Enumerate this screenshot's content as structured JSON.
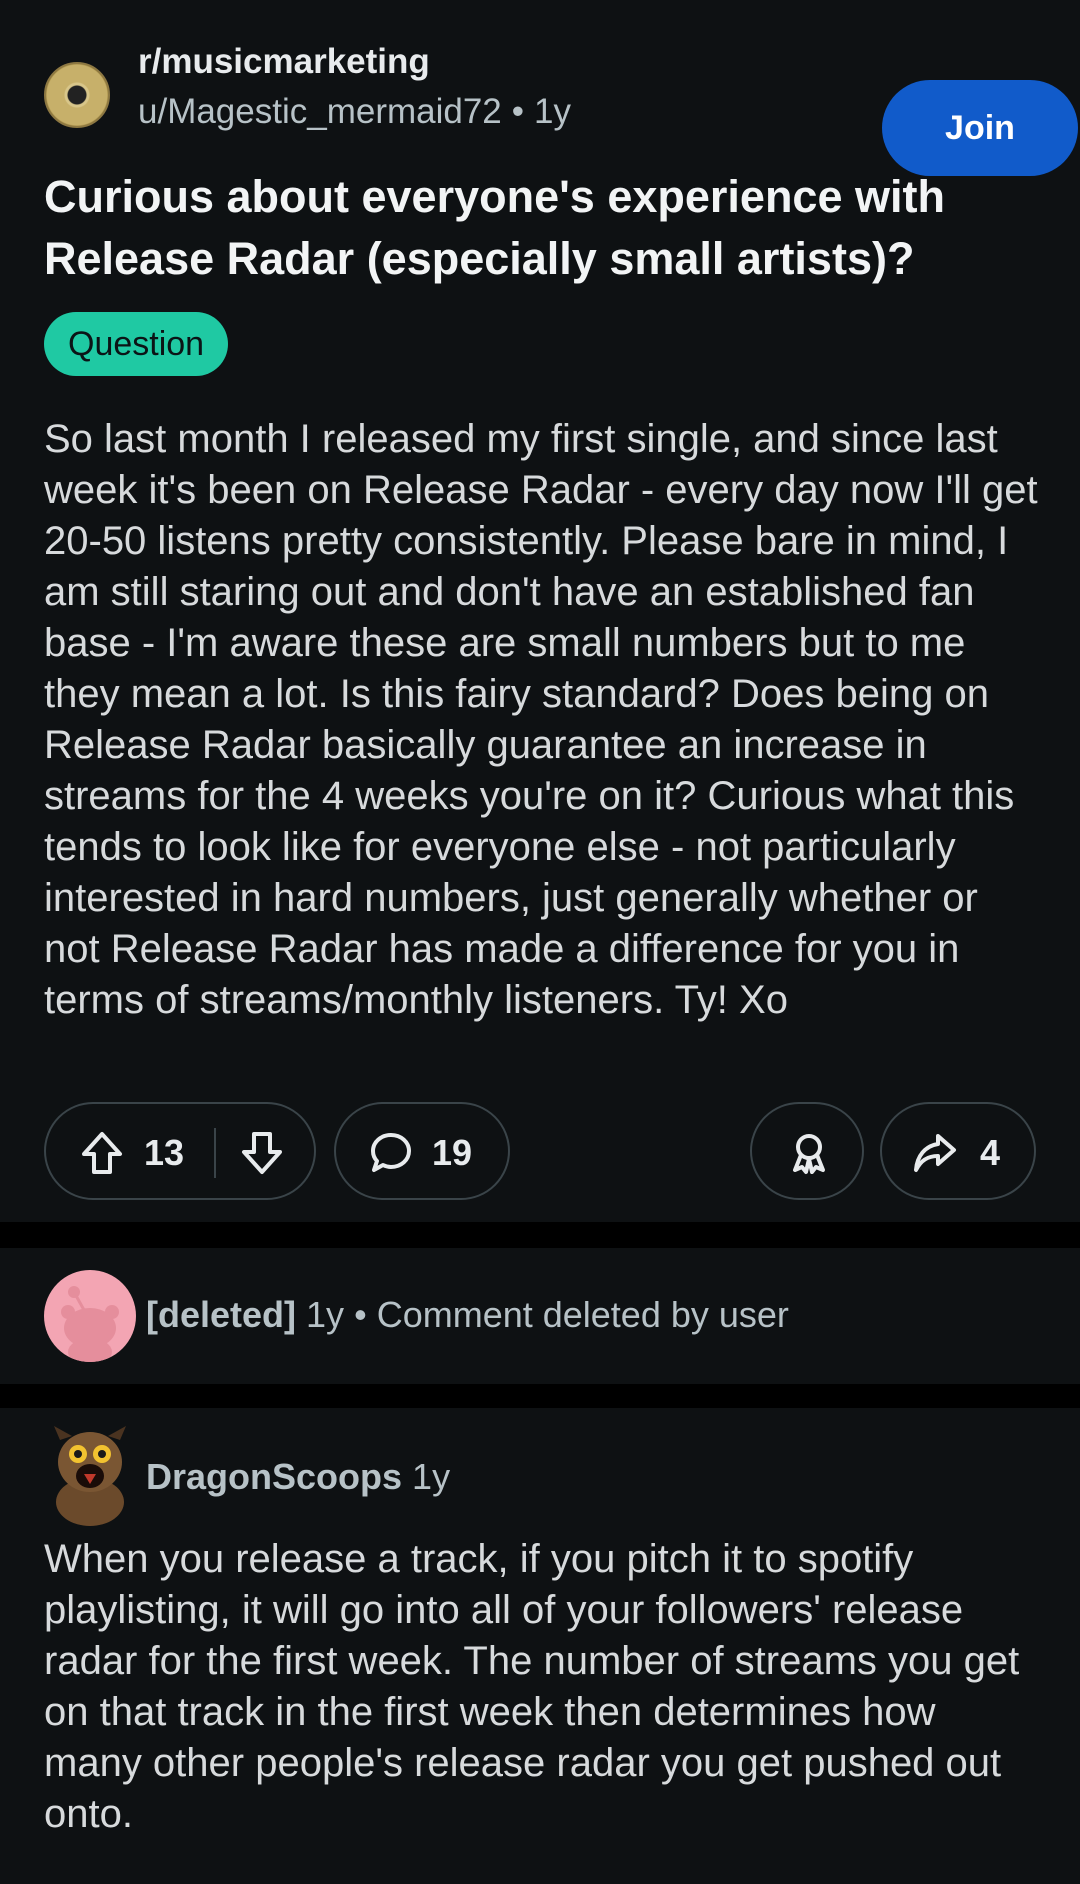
{
  "post": {
    "subreddit": "r/musicmarketing",
    "author": "u/Magestic_mermaid72",
    "separator": "•",
    "age": "1y",
    "join_label": "Join",
    "title": "Curious about everyone's experience with Release Radar (especially small artists)?",
    "flair": "Question",
    "body": "So last month I released my first single, and since last week it's been on Release Radar - every day now I'll get 20-50 listens pretty consistently. Please bare in mind, I am still staring out and don't have an established fan base - I'm aware these are small numbers but to me they mean a lot. Is this fairy standard? Does being on Release Radar basically guarantee an increase in streams for the 4 weeks you're on it? Curious what this tends to look like for everyone else - not particularly interested in hard numbers, just generally whether or not Release Radar has made a difference for you in terms of streams/monthly listeners. Ty! Xo",
    "upvotes": "13",
    "comments": "19",
    "shares": "4",
    "icons": [
      "upvote-icon",
      "downvote-icon",
      "comment-icon",
      "award-icon",
      "share-icon"
    ]
  },
  "comments": [
    {
      "author": "[deleted]",
      "age": "1y",
      "separator": "•",
      "text": "Comment deleted by user"
    },
    {
      "author": "DragonScoops",
      "age": "1y",
      "text": "When you release a track, if you pitch it to spotify playlisting, it will go into all of your followers' release radar for the first week. The number of streams you get on that track in the first week then determines how many other people's release radar you get pushed out onto."
    }
  ],
  "colors": {
    "background": "#0e1113",
    "join_button": "#115bca",
    "flair": "#1fc9a3",
    "deleted_avatar": "#f3a5b3"
  }
}
